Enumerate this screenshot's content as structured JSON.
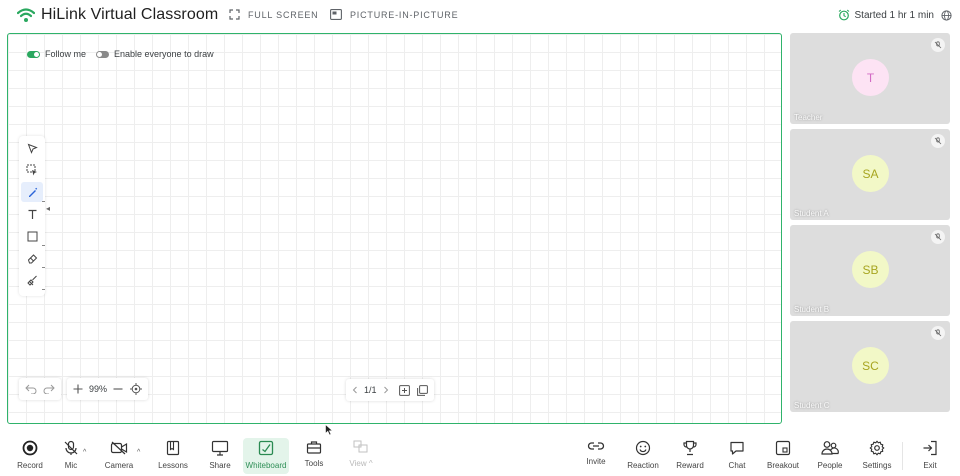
{
  "header": {
    "title": "HiLink Virtual Classroom",
    "full_screen_label": "FULL SCREEN",
    "pip_label": "PICTURE-IN-PICTURE",
    "started_text": "Started 1 hr 1 min"
  },
  "board": {
    "follow_me_label": "Follow me",
    "follow_me_on": true,
    "enable_draw_label": "Enable everyone to draw",
    "enable_draw_on": false,
    "zoom_text": "99%",
    "page_text": "1/1",
    "tools": [
      "select-icon",
      "area-select-icon",
      "pen-icon",
      "text-icon",
      "rectangle-icon",
      "eraser-icon",
      "clear-icon"
    ],
    "active_tool": "pen-icon"
  },
  "participants": [
    {
      "initials": "T",
      "name": "Teacher",
      "avatar_bg": "#fde3f4",
      "avatar_fg": "#d36bc4"
    },
    {
      "initials": "SA",
      "name": "Student A",
      "avatar_bg": "#f2f8c7",
      "avatar_fg": "#a7a520"
    },
    {
      "initials": "SB",
      "name": "Student B",
      "avatar_bg": "#f2f8c7",
      "avatar_fg": "#a7a520"
    },
    {
      "initials": "SC",
      "name": "Student C",
      "avatar_bg": "#f2f8c7",
      "avatar_fg": "#a7a520"
    }
  ],
  "toolbar": {
    "record": "Record",
    "mic": "Mic",
    "camera": "Camera",
    "lessons": "Lessons",
    "share": "Share",
    "whiteboard": "Whiteboard",
    "tools": "Tools",
    "view": "View",
    "invite": "Invite",
    "reaction": "Reaction",
    "reward": "Reward",
    "chat": "Chat",
    "breakout": "Breakout",
    "people": "People",
    "settings": "Settings",
    "exit": "Exit"
  },
  "colors": {
    "accent": "#2fb36b",
    "whiteboard_active_bg": "#e3f4ea"
  }
}
